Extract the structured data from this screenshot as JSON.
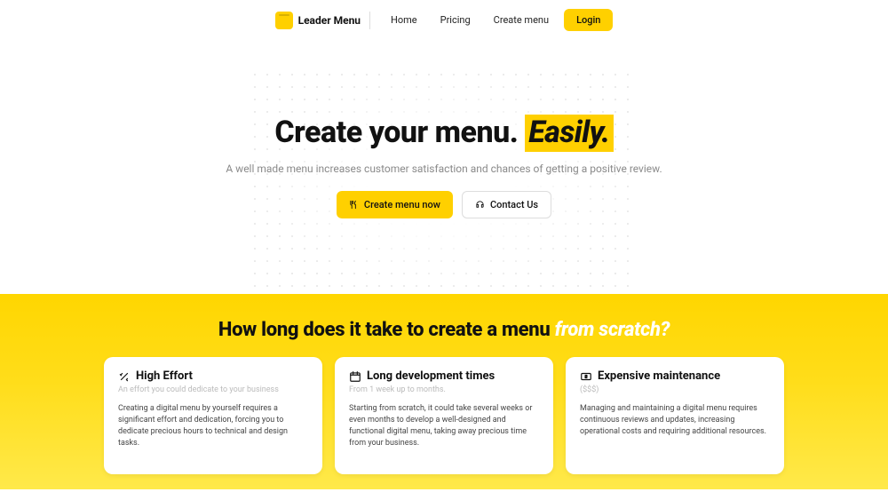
{
  "brand": "Leader Menu",
  "nav": {
    "home": "Home",
    "pricing": "Pricing",
    "create": "Create menu",
    "login": "Login"
  },
  "hero": {
    "title_a": "Create your menu.",
    "title_b": "Easily.",
    "subtitle": "A well made menu increases customer satisfaction and chances of getting a positive review.",
    "cta_primary": "Create menu now",
    "cta_secondary": "Contact Us"
  },
  "section": {
    "title_a": "How long does it take to create a menu",
    "title_b": "from scratch?"
  },
  "cards": [
    {
      "title": "High Effort",
      "sub": "An effort you could dedicate to your business",
      "body": "Creating a digital menu by yourself requires a significant effort and dedication, forcing you to dedicate precious hours to technical and design tasks."
    },
    {
      "title": "Long development times",
      "sub": "From 1 week up to months.",
      "body": "Starting from scratch, it could take several weeks or even months to develop a well-designed and functional digital menu, taking away precious time from your business."
    },
    {
      "title": "Expensive maintenance",
      "sub": "($$$)",
      "body": "Managing and maintaining a digital menu requires continuous reviews and updates, increasing operational costs and requiring additional resources."
    }
  ]
}
